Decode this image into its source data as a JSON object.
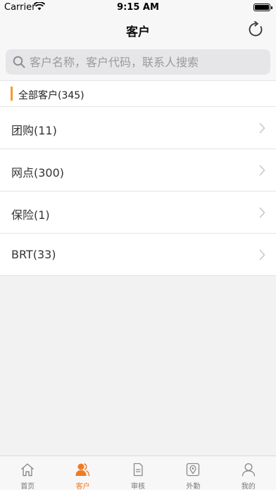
{
  "status_bar": {
    "carrier": "Carrier",
    "time": "9:15 AM"
  },
  "nav": {
    "title": "客户",
    "refresh_icon": "refresh-icon"
  },
  "search": {
    "placeholder": "客户名称，客户代码，联系人搜索",
    "value": ""
  },
  "group_header": {
    "label": "全部客户(345)"
  },
  "list": {
    "items": [
      {
        "label": "团购(11)"
      },
      {
        "label": "网点(300)"
      },
      {
        "label": "保险(1)"
      },
      {
        "label": "BRT(33)"
      }
    ]
  },
  "tabs": [
    {
      "label": "首页",
      "icon": "home-icon",
      "active": false
    },
    {
      "label": "客户",
      "icon": "customer-icon",
      "active": true
    },
    {
      "label": "审核",
      "icon": "document-icon",
      "active": false
    },
    {
      "label": "外勤",
      "icon": "location-icon",
      "active": false
    },
    {
      "label": "我的",
      "icon": "user-icon",
      "active": false
    }
  ],
  "colors": {
    "accent": "#f07a22",
    "header_bar": "#f39c2c",
    "background": "#f2f2f2"
  }
}
